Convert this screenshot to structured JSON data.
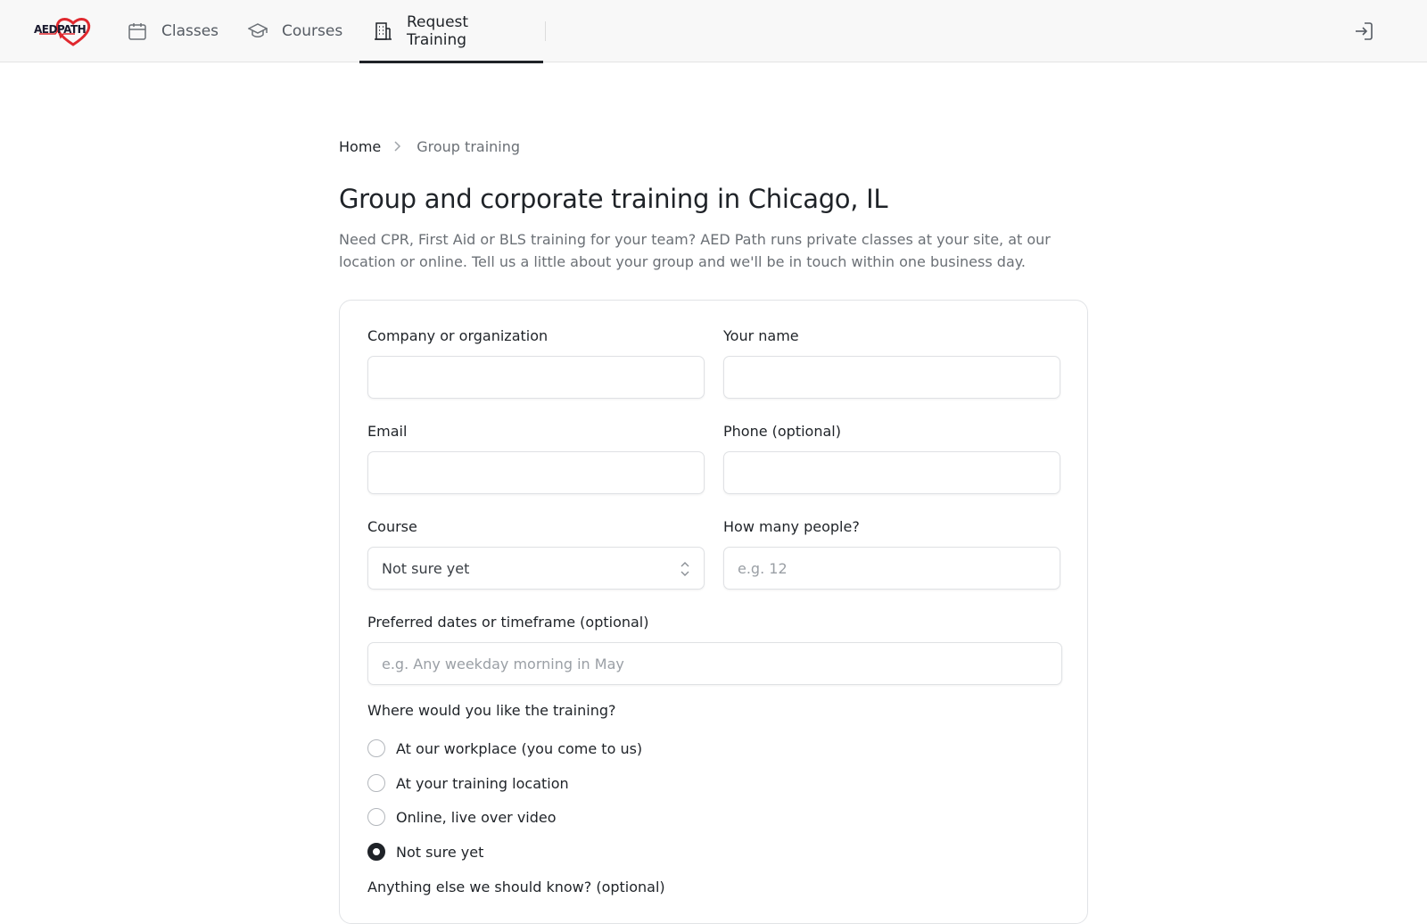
{
  "nav": {
    "logo_text": "AEDPATH",
    "items": [
      {
        "label": "Classes",
        "icon": "calendar-icon"
      },
      {
        "label": "Courses",
        "icon": "graduation-cap-icon"
      },
      {
        "label": "Request Training",
        "icon": "building-icon",
        "active": true
      }
    ],
    "signin_icon": "sign-in-icon"
  },
  "breadcrumb": {
    "home": "Home",
    "current": "Group training"
  },
  "page": {
    "title": "Group and corporate training in Chicago, IL",
    "intro": "Need CPR, First Aid or BLS training for your team? AED Path runs private classes at your site, at our location or online. Tell us a little about your group and we'll be in touch within one business day."
  },
  "form": {
    "company": {
      "label": "Company or organization",
      "value": "",
      "placeholder": ""
    },
    "name": {
      "label": "Your name",
      "value": "",
      "placeholder": ""
    },
    "email": {
      "label": "Email",
      "value": "",
      "placeholder": ""
    },
    "phone": {
      "label": "Phone (optional)",
      "value": "",
      "placeholder": ""
    },
    "course": {
      "label": "Course",
      "selected": "Not sure yet"
    },
    "people": {
      "label": "How many people?",
      "placeholder": "e.g. 12"
    },
    "dates": {
      "label": "Preferred dates or timeframe (optional)",
      "placeholder": "e.g. Any weekday morning in May"
    },
    "location": {
      "label": "Where would you like the training?",
      "options": [
        {
          "label": "At our workplace (you come to us)",
          "checked": false
        },
        {
          "label": "At your training location",
          "checked": false
        },
        {
          "label": "Online, live over video",
          "checked": false
        },
        {
          "label": "Not sure yet",
          "checked": true
        }
      ]
    },
    "notes_label_partial": "Anything else we should know? (optional)"
  },
  "colors": {
    "brand_red": "#e0282e",
    "text_primary": "#1f2328",
    "text_muted": "#6b7076"
  }
}
